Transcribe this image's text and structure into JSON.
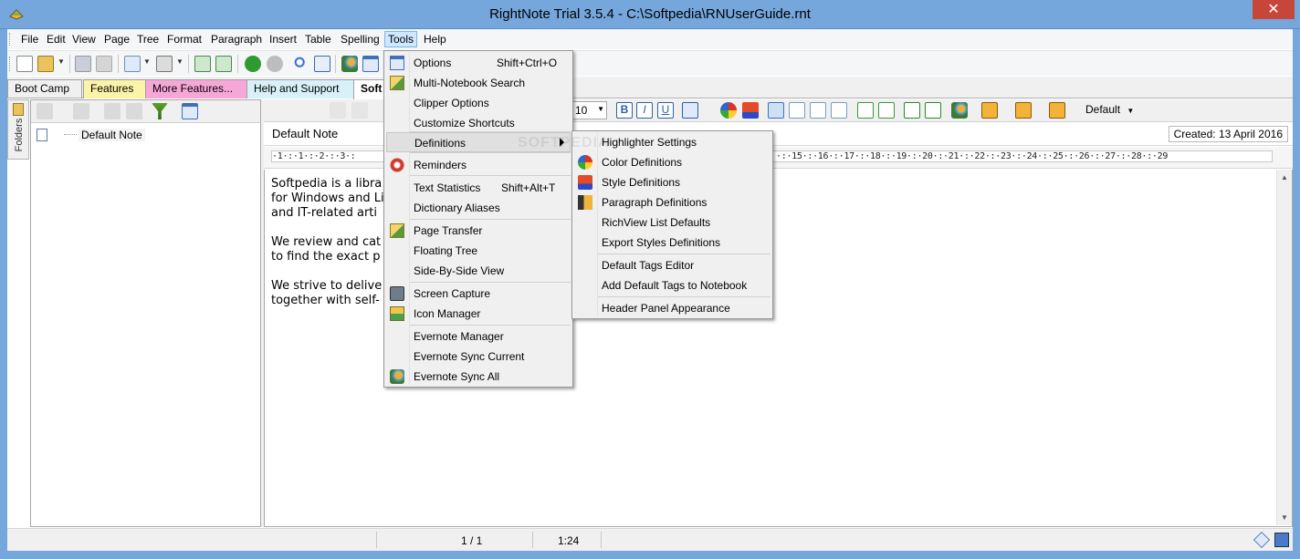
{
  "window": {
    "title": "RightNote Trial 3.5.4 - C:\\Softpedia\\RNUserGuide.rnt",
    "close": "✕"
  },
  "menubar": [
    "File",
    "Edit",
    "View",
    "Page",
    "Tree",
    "Format",
    "Paragraph",
    "Insert",
    "Table",
    "Spelling",
    "Tools",
    "Help"
  ],
  "tabs": [
    {
      "label": "Boot Camp",
      "color": "#f0f0f0"
    },
    {
      "label": "Features",
      "color": "#fbf3a8"
    },
    {
      "label": "More Features...",
      "color": "#f7a6d8"
    },
    {
      "label": "Help and Support",
      "color": "#d8f1f8"
    },
    {
      "label": "Soft",
      "color": "#ffffff"
    }
  ],
  "left_panel": {
    "vertical_tab": "Folders",
    "tree_item": "Default Note"
  },
  "editor": {
    "note_title": "Default Note",
    "created": "Created: 13 April 2016",
    "font_size": "10",
    "style_select": "Default",
    "ruler": "·1·:·1·:·2·:·3·:",
    "ruler_right": "·:·15·:·16·:·17·:·18·:·19·:·20·:·21·:·22·:·23·:·24·:·25·:·26·:·27·:·28·:·29",
    "text_lines": [
      "Softpedia is a libra",
      "for Windows and Li",
      "and IT-related arti",
      "",
      "We review and cat",
      "to find the exact p",
      "",
      "We strive to delive",
      "together with self-"
    ]
  },
  "status": {
    "page": "1 / 1",
    "position": "1:24"
  },
  "tools_menu": {
    "items": [
      {
        "label": "Options",
        "shortcut": "Shift+Ctrl+O",
        "icon": "options-icon"
      },
      {
        "label": "Multi-Notebook Search",
        "shortcut": "",
        "icon": "multi-search-icon"
      },
      {
        "label": "Clipper Options",
        "shortcut": "",
        "icon": ""
      },
      {
        "label": "Customize Shortcuts",
        "shortcut": "",
        "icon": ""
      },
      {
        "label": "Definitions",
        "shortcut": "",
        "icon": ""
      },
      {
        "label": "Reminders",
        "shortcut": "",
        "icon": "reminders-icon"
      },
      {
        "label": "Text Statistics",
        "shortcut": "Shift+Alt+T",
        "icon": ""
      },
      {
        "label": "Dictionary Aliases",
        "shortcut": "",
        "icon": ""
      },
      {
        "label": "Page Transfer",
        "shortcut": "",
        "icon": "page-transfer-icon"
      },
      {
        "label": "Floating Tree",
        "shortcut": "",
        "icon": ""
      },
      {
        "label": "Side-By-Side View",
        "shortcut": "",
        "icon": ""
      },
      {
        "label": "Screen Capture",
        "shortcut": "",
        "icon": "camera-icon"
      },
      {
        "label": "Icon Manager",
        "shortcut": "",
        "icon": "icon-manager-icon"
      },
      {
        "label": "Evernote Manager",
        "shortcut": "",
        "icon": ""
      },
      {
        "label": "Evernote Sync Current",
        "shortcut": "",
        "icon": ""
      },
      {
        "label": "Evernote Sync All",
        "shortcut": "",
        "icon": "evernote-sync-icon"
      }
    ]
  },
  "definitions_menu": {
    "items": [
      {
        "label": "Highlighter Settings",
        "icon": ""
      },
      {
        "label": "Color Definitions",
        "icon": "color-palette-icon"
      },
      {
        "label": "Style Definitions",
        "icon": "style-abc-icon"
      },
      {
        "label": "Paragraph Definitions",
        "icon": "paragraph-icon"
      },
      {
        "label": "RichView List Defaults",
        "icon": ""
      },
      {
        "label": "Export Styles Definitions",
        "icon": ""
      },
      {
        "label": "Default Tags Editor",
        "icon": ""
      },
      {
        "label": "Add Default Tags to Notebook",
        "icon": ""
      },
      {
        "label": "Header Panel Appearance",
        "icon": ""
      }
    ]
  },
  "watermark": "SOFTPEDIA"
}
